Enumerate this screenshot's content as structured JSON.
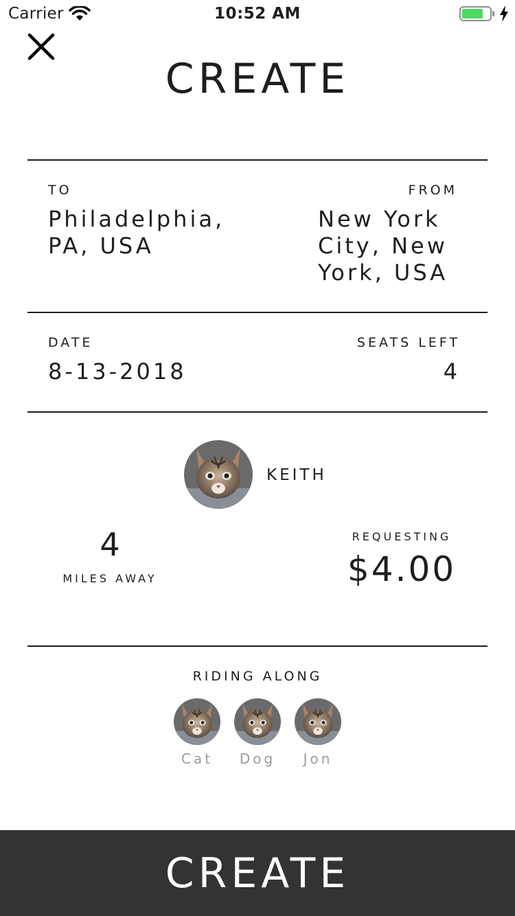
{
  "status_bar": {
    "carrier": "Carrier",
    "time": "10:52 AM"
  },
  "header": {
    "title": "CREATE"
  },
  "route": {
    "to_label": "TO",
    "to_value": "Philadelphia, PA, USA",
    "from_label": "FROM",
    "from_value": "New York City, New York, USA"
  },
  "trip": {
    "date_label": "DATE",
    "date_value": "8-13-2018",
    "seats_label": "SEATS LEFT",
    "seats_value": "4"
  },
  "driver": {
    "name": "KEITH",
    "distance_value": "4",
    "distance_label": "MILES AWAY",
    "requesting_label": "REQUESTING",
    "price": "$4.00"
  },
  "riders": {
    "title": "RIDING ALONG",
    "items": [
      {
        "name": "Cat"
      },
      {
        "name": "Dog"
      },
      {
        "name": "Jon"
      }
    ]
  },
  "footer": {
    "create_label": "CREATE"
  },
  "colors": {
    "battery": "#4cd964",
    "footer_bg": "#333333",
    "muted_text": "#9b9b9b"
  }
}
